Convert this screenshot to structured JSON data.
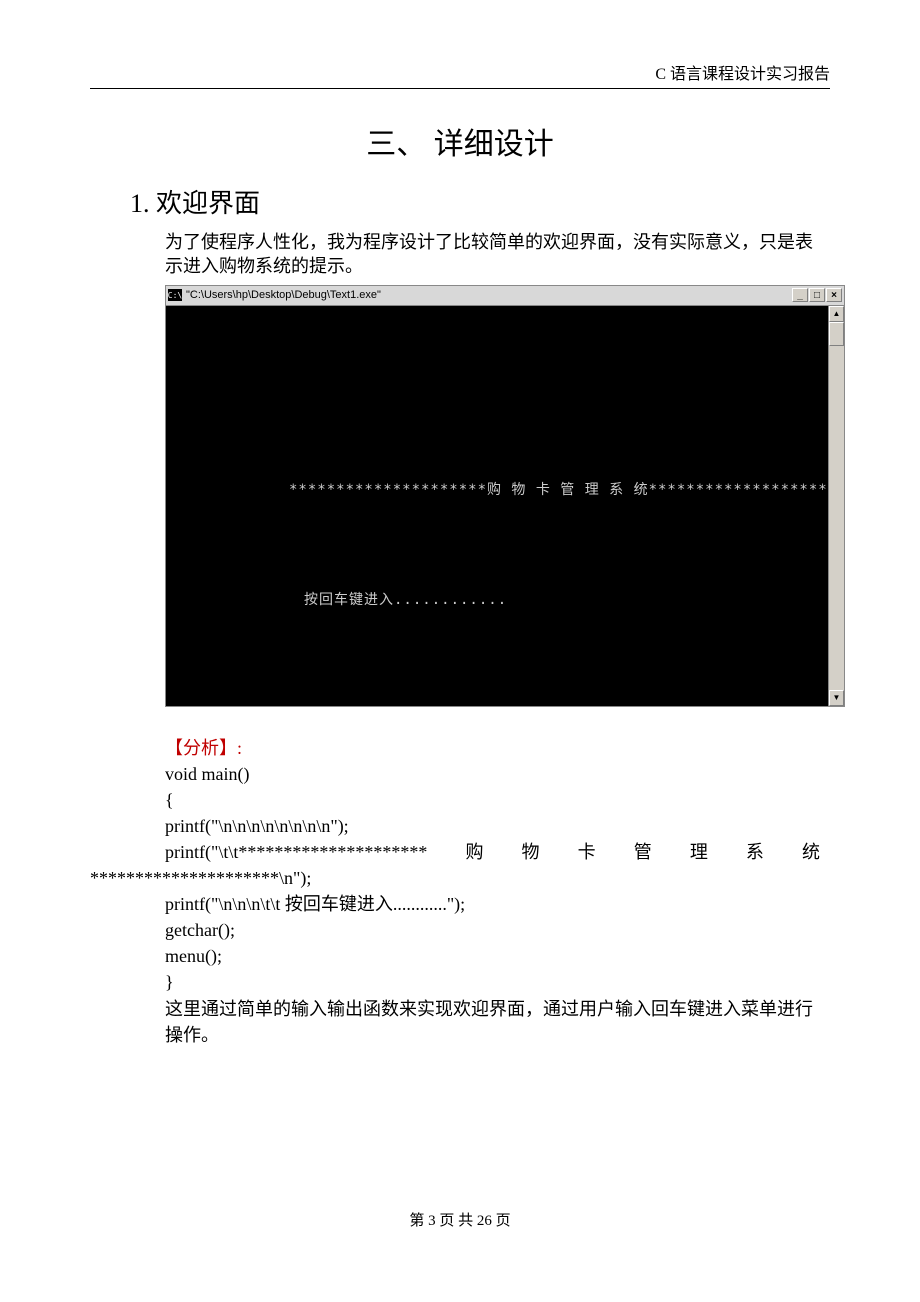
{
  "header": {
    "report_title": "C 语言课程设计实习报告"
  },
  "section": {
    "title": "三、  详细设计",
    "subsection_number": "1.",
    "subsection_title": "欢迎界面",
    "intro_text": "为了使程序人性化，我为程序设计了比较简单的欢迎界面，没有实际意义，只是表示进入购物系统的提示。"
  },
  "console": {
    "title": "\"C:\\Users\\hp\\Desktop\\Debug\\Text1.exe\"",
    "icon_label": "C:\\",
    "buttons": {
      "minimize": "_",
      "maximize": "□",
      "close": "×"
    },
    "line1": "*********************购 物 卡 管 理 系 统*********************",
    "line2": "按回车键进入............"
  },
  "analysis": {
    "label": "【分析】:",
    "code_lines": {
      "l1": "void main()",
      "l2": "{",
      "l3": " printf(\"\\n\\n\\n\\n\\n\\n\\n\\n\");",
      "l4_parts": [
        "    printf(\"\\t\\t*********************",
        "购",
        "物",
        "卡",
        "管",
        "理",
        "系",
        "统"
      ],
      "l5": "*********************\\n\");",
      "l6": " printf(\"\\n\\n\\n\\t\\t  按回车键进入............\");",
      "l7": " getchar();",
      "l8": " menu();",
      "l9": "}"
    },
    "explanation": "这里通过简单的输入输出函数来实现欢迎界面，通过用户输入回车键进入菜单进行操作。"
  },
  "footer": {
    "text": "第 3 页 共 26 页"
  }
}
